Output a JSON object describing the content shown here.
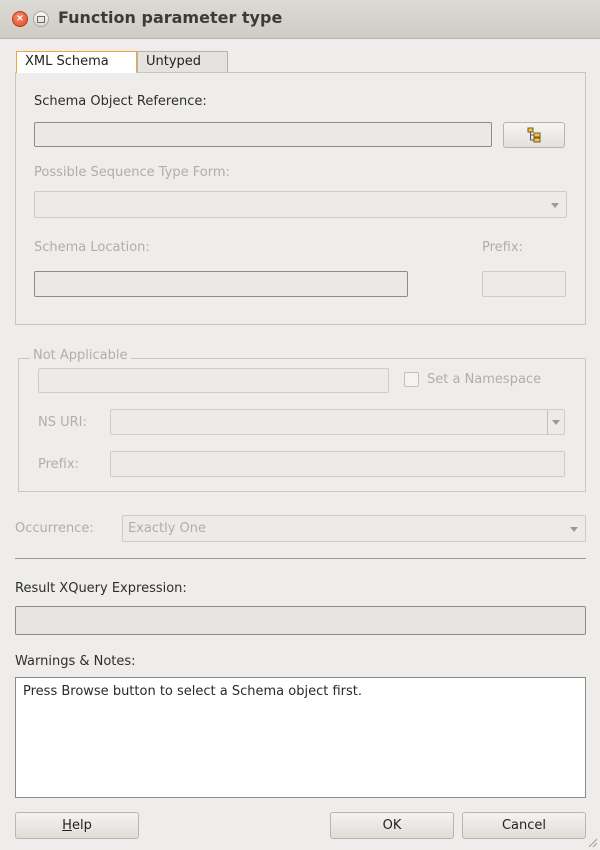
{
  "window": {
    "title": "Function parameter type",
    "close_glyph": "×"
  },
  "tabs": [
    {
      "label": "XML Schema",
      "active": true
    },
    {
      "label": "Untyped",
      "active": false
    }
  ],
  "schema": {
    "object_reference_label": "Schema Object Reference:",
    "object_reference_value": "",
    "browse_icon": "tree-hierarchy-icon",
    "sequence_type_form_label": "Possible Sequence Type Form:",
    "sequence_type_form_value": "",
    "location_label": "Schema Location:",
    "location_value": "",
    "prefix_label": "Prefix:",
    "prefix_value": ""
  },
  "namespace": {
    "group_label": "Not Applicable",
    "value": "",
    "set_namespace_label": "Set a Namespace",
    "set_namespace_checked": false,
    "ns_uri_label": "NS URI:",
    "ns_uri_value": "",
    "prefix_label": "Prefix:",
    "prefix_value": ""
  },
  "occurrence": {
    "label": "Occurrence:",
    "value": "Exactly One"
  },
  "result": {
    "label": "Result XQuery Expression:",
    "value": ""
  },
  "warnings": {
    "label": "Warnings & Notes:",
    "text": "Press Browse button to select a Schema object first."
  },
  "buttons": {
    "help_first": "H",
    "help_rest": "elp",
    "ok": "OK",
    "cancel": "Cancel"
  },
  "colors": {
    "active_tab_border": "#f0a33e",
    "close_button": "#df4a24",
    "window_bg": "#efedeb"
  }
}
